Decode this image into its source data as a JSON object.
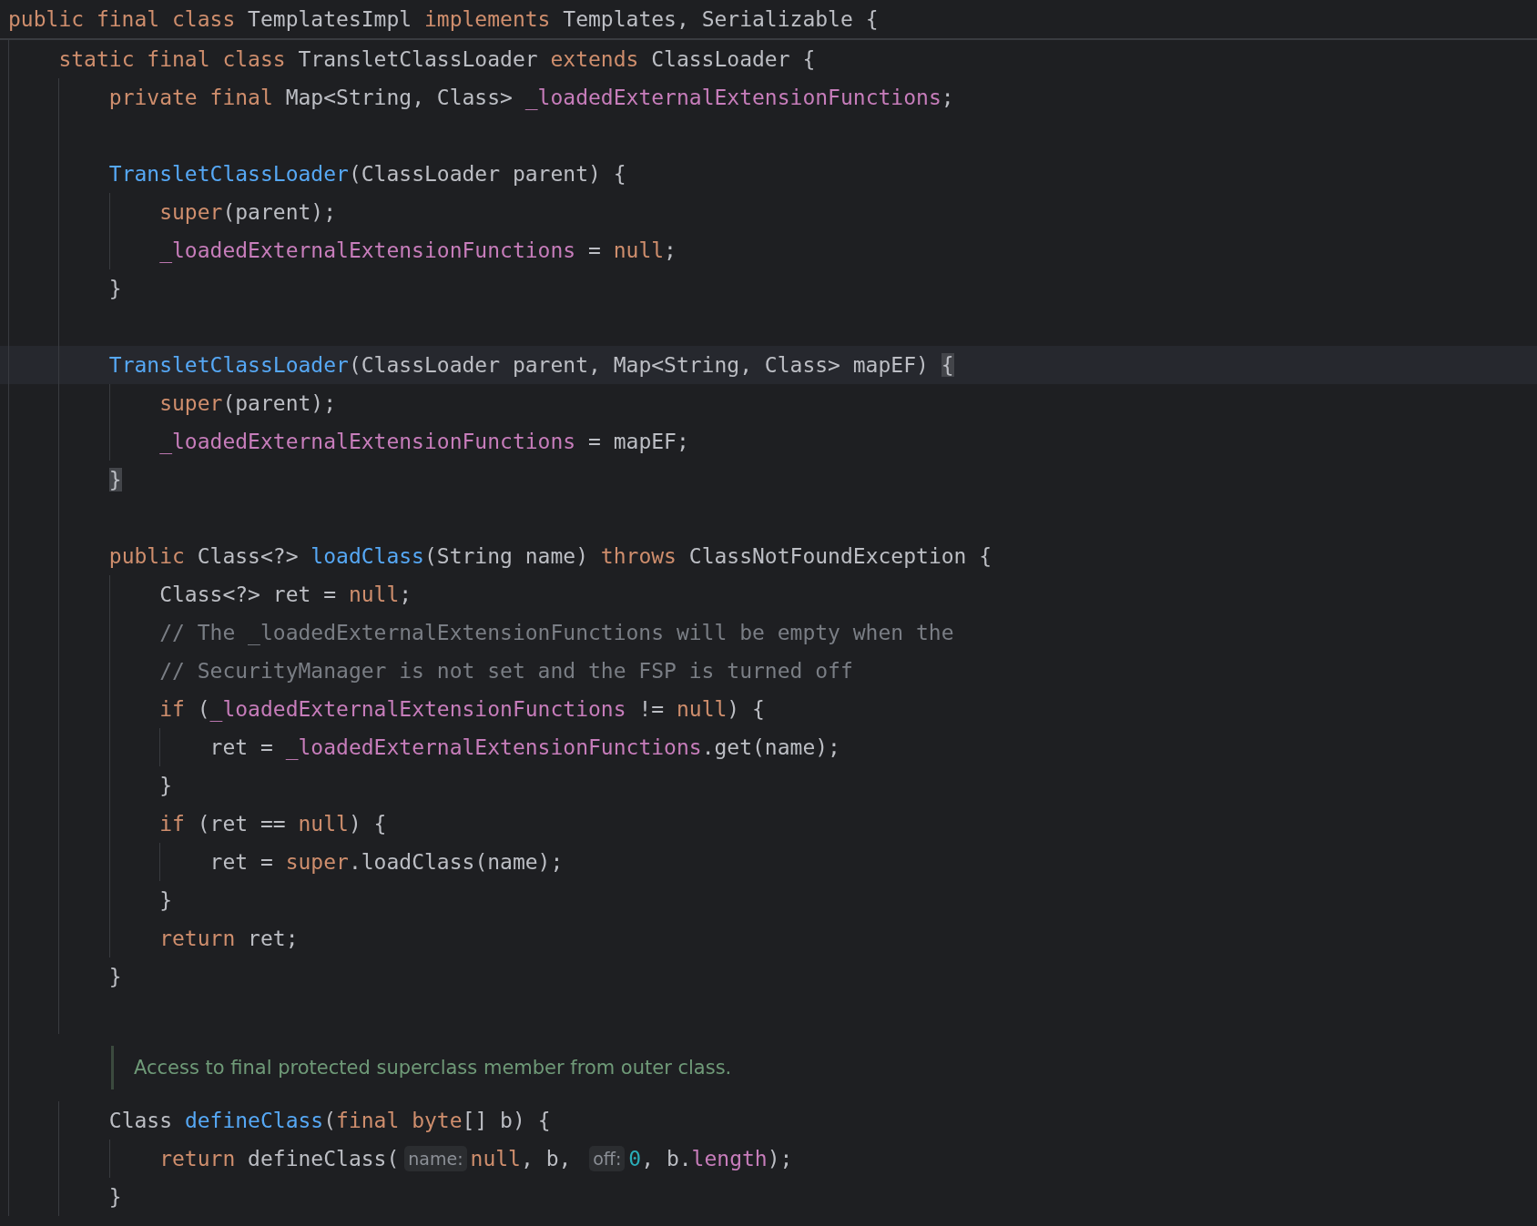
{
  "sticky_header": {
    "segments": [
      {
        "kind": "code",
        "tokens": [
          {
            "kind": "keyword",
            "text": "public final class "
          },
          {
            "kind": "plain",
            "text": "TemplatesImpl "
          },
          {
            "kind": "keyword",
            "text": "implements "
          },
          {
            "kind": "plain",
            "text": "Templates, Serializable {"
          }
        ]
      }
    ]
  },
  "lines": [
    {
      "current": false,
      "segments": [
        {
          "kind": "code",
          "tokens": [
            {
              "kind": "keyword",
              "text": "    static final class "
            },
            {
              "kind": "plain",
              "text": "TransletClassLoader "
            },
            {
              "kind": "keyword",
              "text": "extends "
            },
            {
              "kind": "plain",
              "text": "ClassLoader {"
            }
          ]
        }
      ]
    },
    {
      "current": false,
      "segments": [
        {
          "kind": "code",
          "tokens": [
            {
              "kind": "keyword",
              "text": "        private final "
            },
            {
              "kind": "plain",
              "text": "Map<String, Class> "
            },
            {
              "kind": "field",
              "text": "_loadedExternalExtensionFunctions"
            },
            {
              "kind": "plain",
              "text": ";"
            }
          ]
        }
      ]
    },
    {
      "current": false
    },
    {
      "current": false,
      "segments": [
        {
          "kind": "code",
          "tokens": [
            {
              "kind": "declaration",
              "text": "        TransletClassLoader"
            },
            {
              "kind": "plain",
              "text": "(ClassLoader parent) {"
            }
          ]
        }
      ]
    },
    {
      "current": false,
      "segments": [
        {
          "kind": "code",
          "tokens": [
            {
              "kind": "keyword",
              "text": "            super"
            },
            {
              "kind": "plain",
              "text": "(parent);"
            }
          ]
        }
      ]
    },
    {
      "current": false,
      "segments": [
        {
          "kind": "code",
          "tokens": [
            {
              "kind": "field",
              "text": "            _loadedExternalExtensionFunctions"
            },
            {
              "kind": "plain",
              "text": " = "
            },
            {
              "kind": "keyword",
              "text": "null"
            },
            {
              "kind": "plain",
              "text": ";"
            }
          ]
        }
      ]
    },
    {
      "current": false,
      "segments": [
        {
          "kind": "code",
          "tokens": [
            {
              "kind": "plain",
              "text": "        }"
            }
          ]
        }
      ]
    },
    {
      "current": false
    },
    {
      "current": true,
      "segments": [
        {
          "kind": "code",
          "tokens": [
            {
              "kind": "declaration",
              "text": "        TransletClassLoader"
            },
            {
              "kind": "plain",
              "text": "(ClassLoader parent, Map<String, Class> mapEF) "
            },
            {
              "kind": "brace-match",
              "text": "{"
            }
          ]
        }
      ]
    },
    {
      "current": false,
      "segments": [
        {
          "kind": "code",
          "tokens": [
            {
              "kind": "keyword",
              "text": "            super"
            },
            {
              "kind": "plain",
              "text": "(parent);"
            }
          ]
        }
      ]
    },
    {
      "current": false,
      "segments": [
        {
          "kind": "code",
          "tokens": [
            {
              "kind": "field",
              "text": "            _loadedExternalExtensionFunctions"
            },
            {
              "kind": "plain",
              "text": " = mapEF;"
            }
          ]
        }
      ]
    },
    {
      "current": false,
      "segments": [
        {
          "kind": "code",
          "tokens": [
            {
              "kind": "brace-match",
              "text": "        }"
            }
          ]
        }
      ]
    },
    {
      "current": false
    },
    {
      "current": false,
      "segments": [
        {
          "kind": "code",
          "tokens": [
            {
              "kind": "keyword",
              "text": "        public "
            },
            {
              "kind": "plain",
              "text": "Class<?> "
            },
            {
              "kind": "declaration",
              "text": "loadClass"
            },
            {
              "kind": "plain",
              "text": "(String name) "
            },
            {
              "kind": "keyword",
              "text": "throws "
            },
            {
              "kind": "plain",
              "text": "ClassNotFoundException {"
            }
          ]
        }
      ]
    },
    {
      "current": false,
      "segments": [
        {
          "kind": "code",
          "tokens": [
            {
              "kind": "plain",
              "text": "            Class<?> ret = "
            },
            {
              "kind": "keyword",
              "text": "null"
            },
            {
              "kind": "plain",
              "text": ";"
            }
          ]
        }
      ]
    },
    {
      "current": false,
      "segments": [
        {
          "kind": "code",
          "tokens": [
            {
              "kind": "comment",
              "text": "            // The _loadedExternalExtensionFunctions will be empty when the"
            }
          ]
        }
      ]
    },
    {
      "current": false,
      "segments": [
        {
          "kind": "code",
          "tokens": [
            {
              "kind": "comment",
              "text": "            // SecurityManager is not set and the FSP is turned off"
            }
          ]
        }
      ]
    },
    {
      "current": false,
      "segments": [
        {
          "kind": "code",
          "tokens": [
            {
              "kind": "keyword",
              "text": "            if "
            },
            {
              "kind": "plain",
              "text": "("
            },
            {
              "kind": "field",
              "text": "_loadedExternalExtensionFunctions"
            },
            {
              "kind": "plain",
              "text": " != "
            },
            {
              "kind": "keyword",
              "text": "null"
            },
            {
              "kind": "plain",
              "text": ") {"
            }
          ]
        }
      ]
    },
    {
      "current": false,
      "segments": [
        {
          "kind": "code",
          "tokens": [
            {
              "kind": "plain",
              "text": "                ret = "
            },
            {
              "kind": "field",
              "text": "_loadedExternalExtensionFunctions"
            },
            {
              "kind": "plain",
              "text": ".get(name);"
            }
          ]
        }
      ]
    },
    {
      "current": false,
      "segments": [
        {
          "kind": "code",
          "tokens": [
            {
              "kind": "plain",
              "text": "            }"
            }
          ]
        }
      ]
    },
    {
      "current": false,
      "segments": [
        {
          "kind": "code",
          "tokens": [
            {
              "kind": "keyword",
              "text": "            if "
            },
            {
              "kind": "plain",
              "text": "(ret == "
            },
            {
              "kind": "keyword",
              "text": "null"
            },
            {
              "kind": "plain",
              "text": ") {"
            }
          ]
        }
      ]
    },
    {
      "current": false,
      "segments": [
        {
          "kind": "code",
          "tokens": [
            {
              "kind": "plain",
              "text": "                ret = "
            },
            {
              "kind": "keyword",
              "text": "super"
            },
            {
              "kind": "plain",
              "text": ".loadClass(name);"
            }
          ]
        }
      ]
    },
    {
      "current": false,
      "segments": [
        {
          "kind": "code",
          "tokens": [
            {
              "kind": "plain",
              "text": "            }"
            }
          ]
        }
      ]
    },
    {
      "current": false,
      "segments": [
        {
          "kind": "code",
          "tokens": [
            {
              "kind": "keyword",
              "text": "            return "
            },
            {
              "kind": "plain",
              "text": "ret;"
            }
          ]
        }
      ]
    },
    {
      "current": false,
      "segments": [
        {
          "kind": "code",
          "tokens": [
            {
              "kind": "plain",
              "text": "        }"
            }
          ]
        }
      ]
    },
    {
      "current": false
    },
    {
      "current": false,
      "segments": [
        {
          "kind": "doc",
          "text": "Access to final protected superclass member from outer class."
        }
      ]
    },
    {
      "current": false,
      "segments": [
        {
          "kind": "code",
          "tokens": [
            {
              "kind": "plain",
              "text": "        Class "
            },
            {
              "kind": "declaration",
              "text": "defineClass"
            },
            {
              "kind": "plain",
              "text": "("
            },
            {
              "kind": "keyword",
              "text": "final byte"
            },
            {
              "kind": "plain",
              "text": "[] b) {"
            }
          ]
        }
      ]
    },
    {
      "current": false,
      "segments": [
        {
          "kind": "code",
          "tokens": [
            {
              "kind": "keyword",
              "text": "            return "
            },
            {
              "kind": "plain",
              "text": "defineClass("
            }
          ]
        },
        {
          "kind": "hint",
          "text": "name:"
        },
        {
          "kind": "code",
          "tokens": [
            {
              "kind": "keyword",
              "text": "null"
            },
            {
              "kind": "plain",
              "text": ", b, "
            }
          ]
        },
        {
          "kind": "hint",
          "text": "off:"
        },
        {
          "kind": "code",
          "tokens": [
            {
              "kind": "number",
              "text": "0"
            },
            {
              "kind": "plain",
              "text": ", b."
            },
            {
              "kind": "field",
              "text": "length"
            },
            {
              "kind": "plain",
              "text": ");"
            }
          ]
        }
      ]
    },
    {
      "current": false,
      "segments": [
        {
          "kind": "code",
          "tokens": [
            {
              "kind": "plain",
              "text": "        }"
            }
          ]
        }
      ]
    }
  ]
}
